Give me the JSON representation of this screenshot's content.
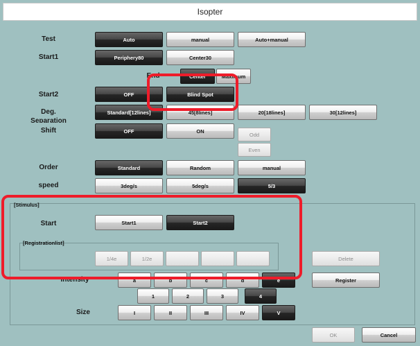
{
  "title": "Isopter",
  "colors": {
    "highlight": "#ee1c2a",
    "background": "#9fc0c0"
  },
  "test": {
    "label": "Test",
    "options": [
      "Auto",
      "manual",
      "Auto+manual"
    ]
  },
  "start1": {
    "label": "Start1",
    "options": [
      "Periphery80",
      "Center30"
    ]
  },
  "end": {
    "label": "End",
    "options": [
      "Center",
      "Maximum"
    ]
  },
  "start2": {
    "label": "Start2",
    "options": [
      "OFF",
      "Blind Spot"
    ]
  },
  "deg_separation": {
    "label": "Deg.",
    "sublabel": "Separation",
    "options": [
      "Standard[12lines]",
      "45[8lines]",
      "20[18lines]",
      "30[12lines]"
    ]
  },
  "shift": {
    "label": "Shift",
    "options": [
      "OFF",
      "ON",
      "Odd",
      "Even"
    ]
  },
  "order": {
    "label": "Order",
    "options": [
      "Standard",
      "Random",
      "manual"
    ]
  },
  "speed": {
    "label": "speed",
    "options": [
      "3deg/s",
      "5deg/s",
      "5/3"
    ]
  },
  "stimulus": {
    "title": "[Stimulus]",
    "start_label": "Start",
    "start_options": [
      "Start1",
      "Start2"
    ],
    "registration_title": "[Registrationlist]",
    "registration_items": [
      "1/4e",
      "1/2e",
      "",
      "",
      ""
    ],
    "delete_label": "Delete",
    "register_label": "Register",
    "intensity_label": "Intensity",
    "intensity_letters": [
      "a",
      "b",
      "c",
      "d",
      "e"
    ],
    "intensity_numbers": [
      "1",
      "2",
      "3",
      "4"
    ],
    "size_label": "Size",
    "size_options": [
      "I",
      "II",
      "III",
      "IV",
      "V"
    ]
  },
  "footer": {
    "ok_label": "OK",
    "cancel_label": "Cancel"
  }
}
